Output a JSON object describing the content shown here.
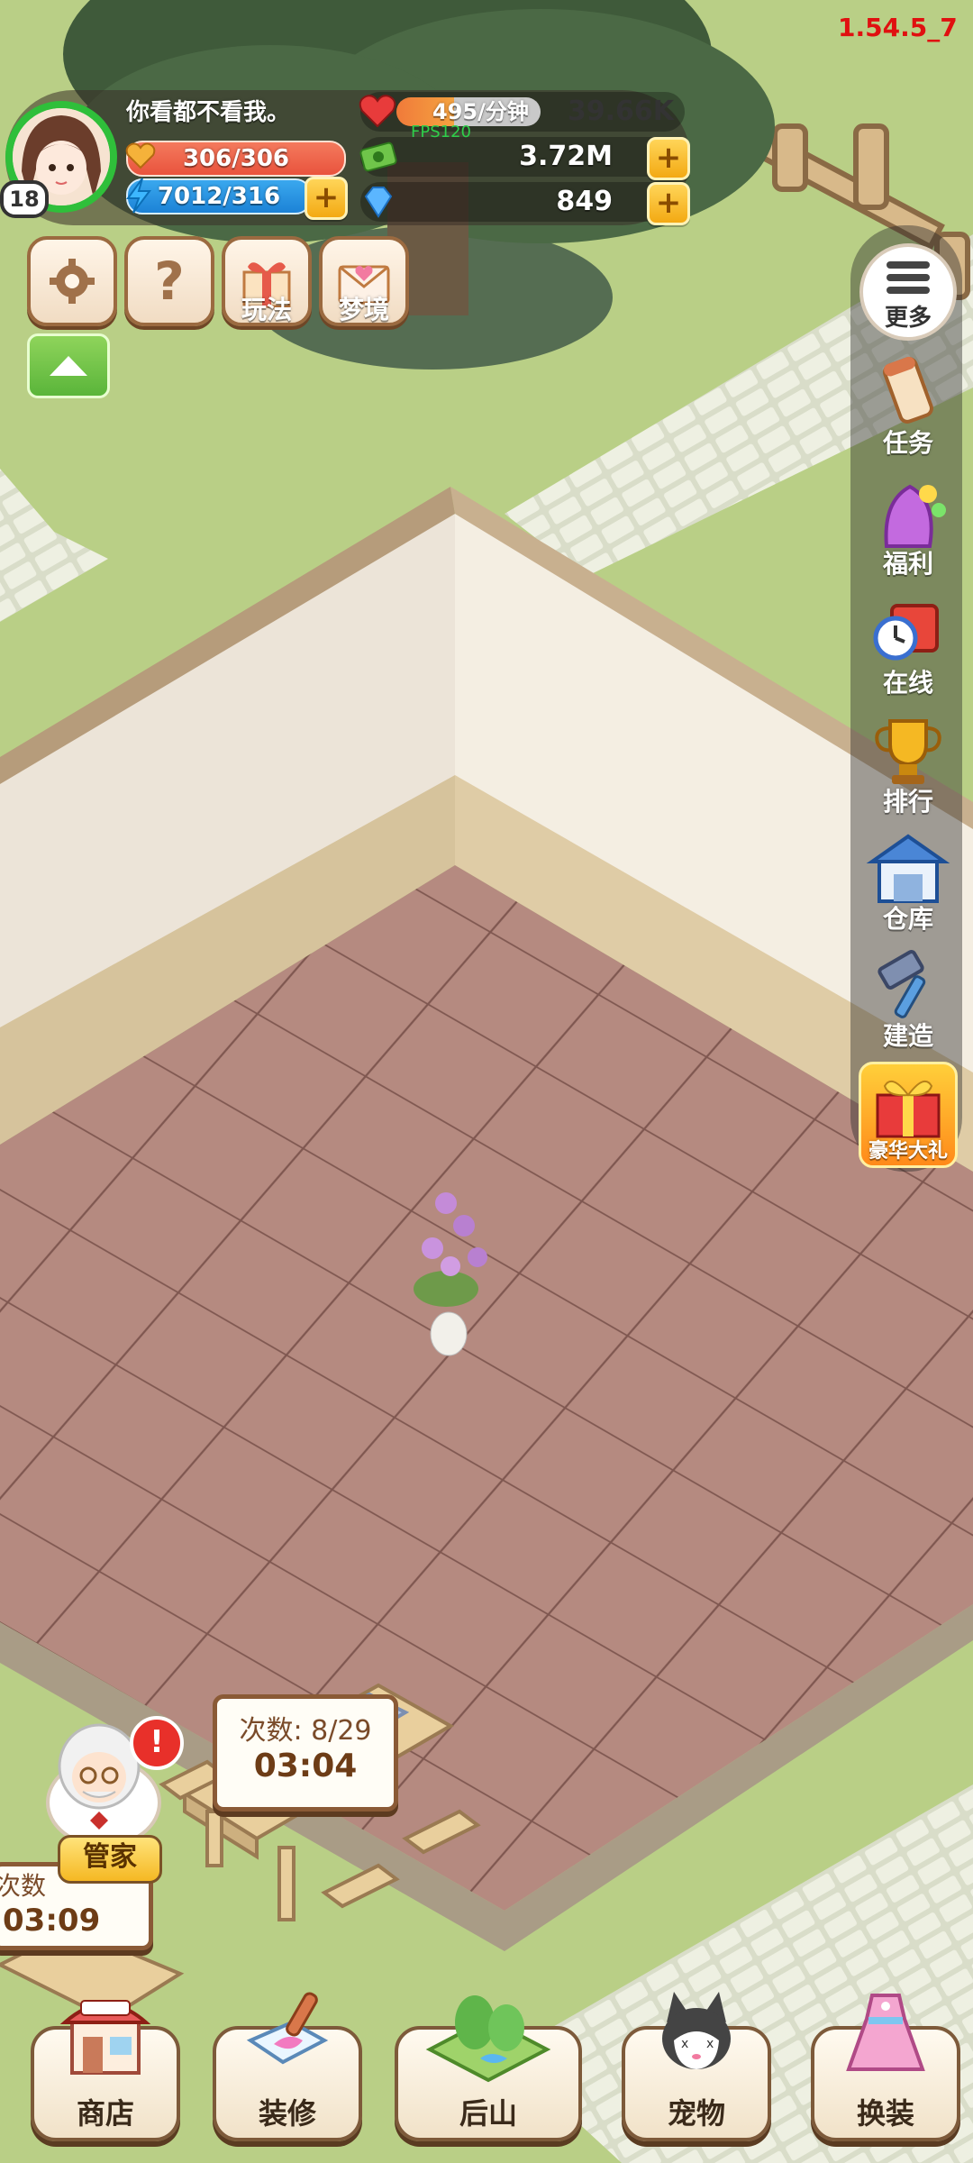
{
  "version": "1.54.5_7",
  "fps_label": "FPS120",
  "player": {
    "name": "你看都不看我。",
    "level": "18",
    "hp": "306/306",
    "energy": "7012/316"
  },
  "resources": {
    "rate": "495/分钟",
    "hearts": "39.66K",
    "cash": "3.72M",
    "gems": "849"
  },
  "top_buttons": {
    "play_label": "玩法",
    "dream_label": "梦境"
  },
  "side_menu": {
    "more": "更多",
    "items": [
      {
        "label": "任务",
        "icon": "scroll-icon"
      },
      {
        "label": "福利",
        "icon": "gift-bag-icon"
      },
      {
        "label": "在线",
        "icon": "clock-gift-icon"
      },
      {
        "label": "排行",
        "icon": "trophy-icon"
      },
      {
        "label": "仓库",
        "icon": "warehouse-icon"
      },
      {
        "label": "建造",
        "icon": "hammer-icon"
      },
      {
        "label": "豪华大礼",
        "icon": "big-gift-icon"
      }
    ]
  },
  "boards": {
    "main_count": "次数: 8/29",
    "main_timer": "03:04",
    "left_count": "次数",
    "left_timer": "03:09"
  },
  "butler": {
    "label": "管家",
    "alert": "!"
  },
  "bottom_nav": [
    {
      "label": "商店",
      "icon": "shop-icon"
    },
    {
      "label": "装修",
      "icon": "paint-brush-icon"
    },
    {
      "label": "后山",
      "icon": "mountain-icon"
    },
    {
      "label": "宠物",
      "icon": "cat-icon"
    },
    {
      "label": "换装",
      "icon": "dress-icon"
    }
  ],
  "colors": {
    "grass": "#b9cf86",
    "floor": "#b58a80",
    "wall": "#ece4d8",
    "accent_gold": "#f5b823"
  }
}
